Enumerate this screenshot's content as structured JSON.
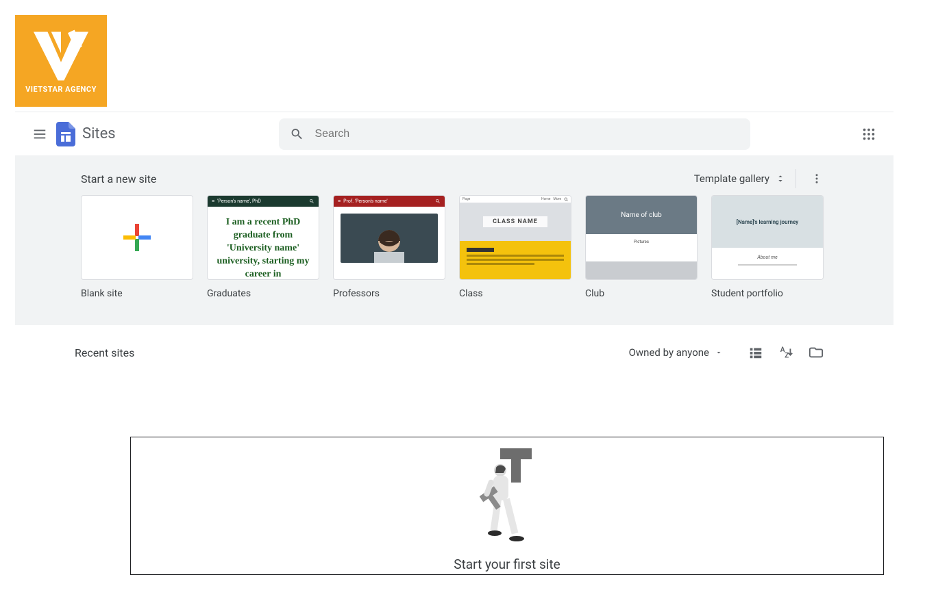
{
  "watermark": {
    "label": "VIETSTAR AGENCY"
  },
  "header": {
    "product_name": "Sites",
    "search_placeholder": "Search"
  },
  "templates": {
    "section_title": "Start a new site",
    "gallery_link": "Template gallery",
    "items": [
      {
        "label": "Blank site"
      },
      {
        "label": "Graduates",
        "thumb_title": "'Person's name', PhD",
        "thumb_text": "I am a recent PhD graduate from 'University name' university, starting my career in"
      },
      {
        "label": "Professors",
        "thumb_title": "Prof. 'Person's name'"
      },
      {
        "label": "Class",
        "thumb_banner": "CLASS NAME"
      },
      {
        "label": "Club",
        "thumb_banner": "Name of club",
        "thumb_sub": "Pictures"
      },
      {
        "label": "Student portfolio",
        "thumb_banner": "[Name]'s learning journey",
        "thumb_sub": "About me"
      }
    ]
  },
  "recent": {
    "title": "Recent sites",
    "owner_filter": "Owned by anyone"
  },
  "empty": {
    "message": "Start your first site"
  }
}
